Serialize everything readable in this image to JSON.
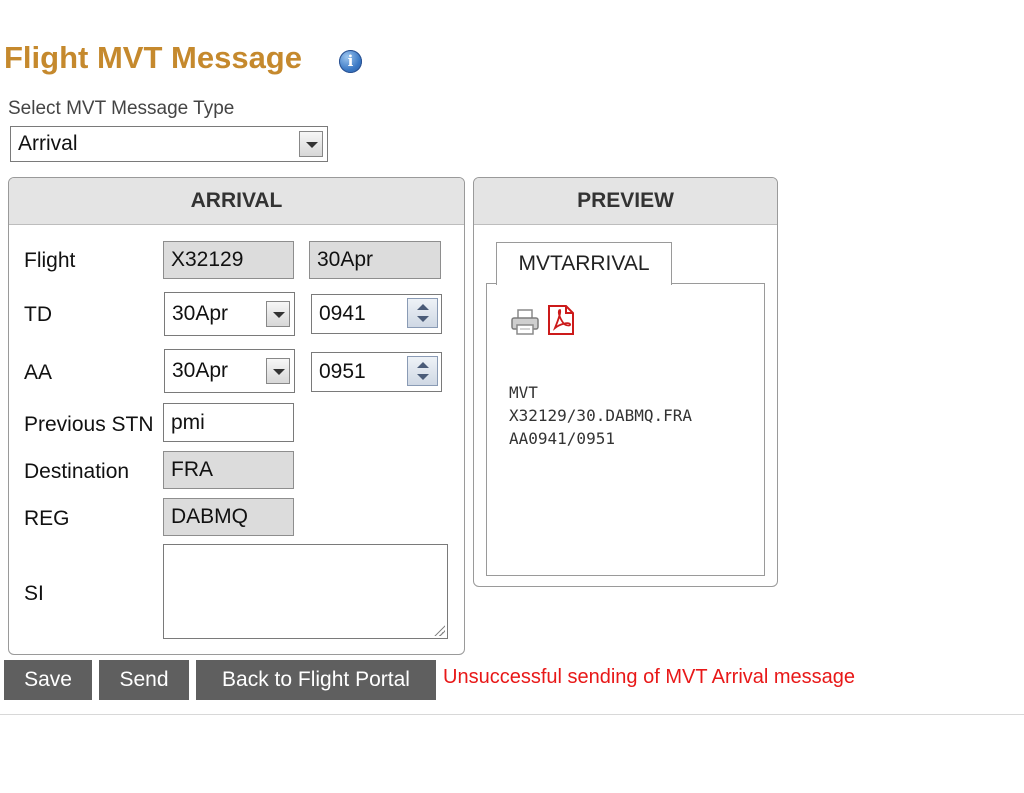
{
  "page": {
    "title": "Flight MVT Message",
    "info_icon": "info-icon"
  },
  "type_select": {
    "label": "Select MVT Message Type",
    "value": "Arrival"
  },
  "arrival": {
    "header": "ARRIVAL",
    "flight": {
      "label": "Flight",
      "number": "X32129",
      "date": "30Apr"
    },
    "td": {
      "label": "TD",
      "date": "30Apr",
      "time": "0941"
    },
    "aa": {
      "label": "AA",
      "date": "30Apr",
      "time": "0951"
    },
    "previous_stn": {
      "label": "Previous STN",
      "value": "pmi"
    },
    "destination": {
      "label": "Destination",
      "value": "FRA"
    },
    "reg": {
      "label": "REG",
      "value": "DABMQ"
    },
    "si": {
      "label": "SI",
      "value": ""
    }
  },
  "preview": {
    "header": "PREVIEW",
    "tab": "MVTARRIVAL",
    "icons": [
      "print-icon",
      "pdf-icon"
    ],
    "lines": [
      "MVT",
      "X32129/30.DABMQ.FRA",
      "AA0941/0951"
    ]
  },
  "actions": {
    "save": "Save",
    "send": "Send",
    "back": "Back to Flight Portal"
  },
  "status": {
    "message": "Unsuccessful sending of MVT Arrival message",
    "color": "#e81818"
  },
  "colors": {
    "title": "#c5892d",
    "button_bg": "#5f5f5f",
    "readonly_bg": "#dcdcdc",
    "panel_header_bg": "#e4e4e4"
  }
}
